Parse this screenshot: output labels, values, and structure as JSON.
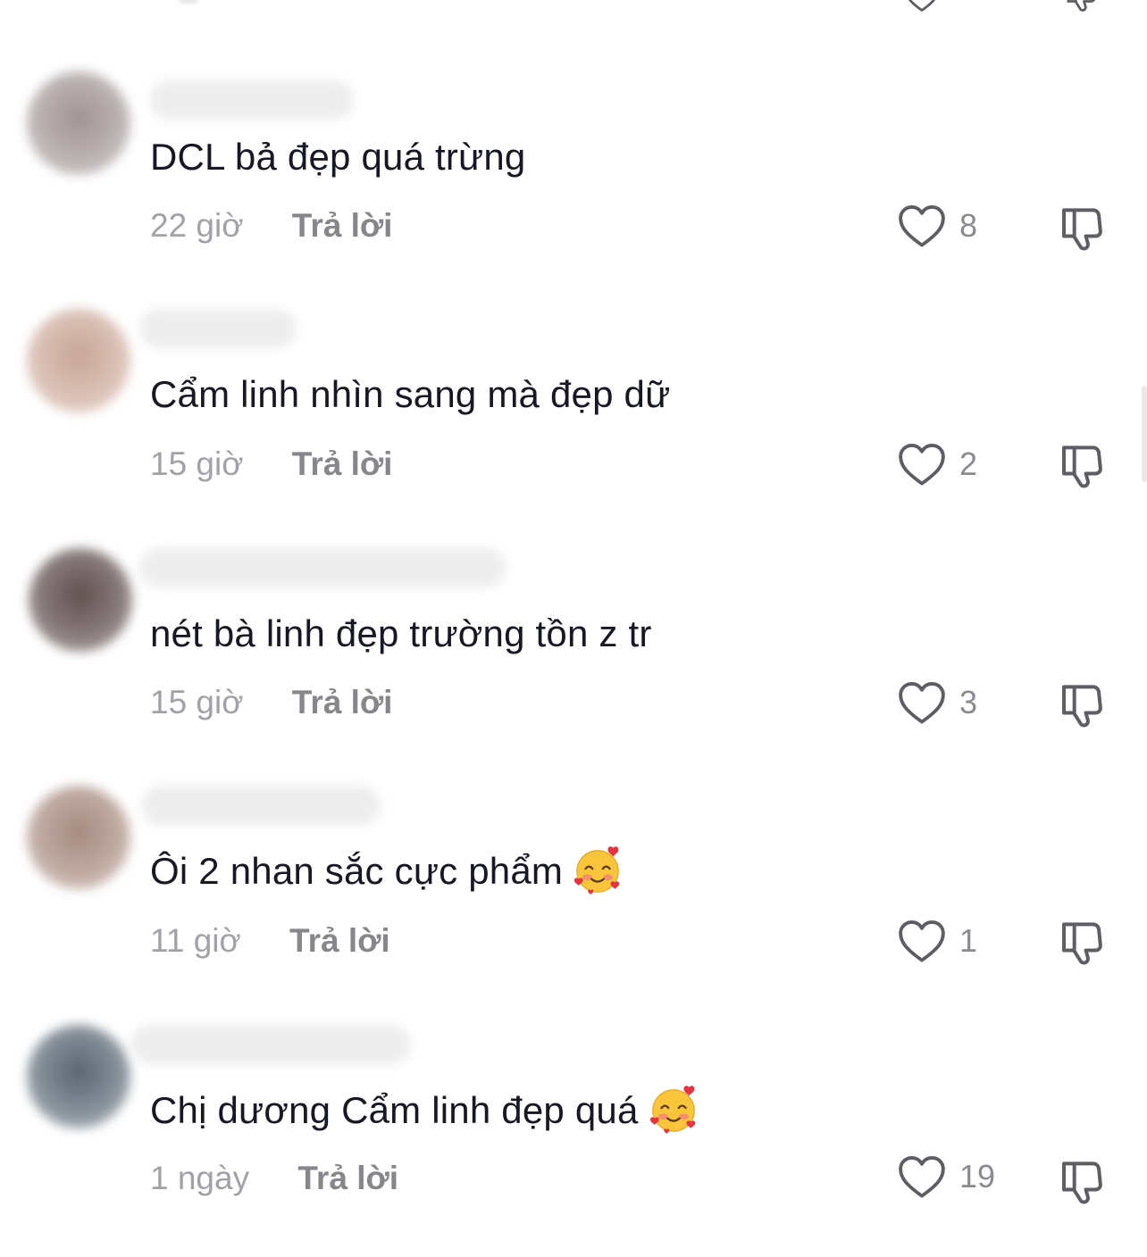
{
  "colors": {
    "text": "#161823",
    "meta": "#a1a2a7",
    "reply": "#86878b",
    "icon": "#5d5e63"
  },
  "icons": {
    "like": "heart-outline-icon",
    "dislike": "thumbs-down-icon",
    "emoji": "smiling-face-with-hearts-emoji"
  },
  "comments": [
    {
      "text": "DCL bả đẹp quá trừng",
      "time": "22 giờ",
      "reply": "Trả lời",
      "likes": "8"
    },
    {
      "text": "Cẩm linh nhìn sang mà đẹp dữ",
      "time": "15 giờ",
      "reply": "Trả lời",
      "likes": "2"
    },
    {
      "text": "nét bà linh đẹp trường tồn z tr",
      "time": "15 giờ",
      "reply": "Trả lời",
      "likes": "3"
    },
    {
      "text": "Ôi 2 nhan sắc cực phẩm",
      "time": "11 giờ",
      "reply": "Trả lời",
      "likes": "1"
    },
    {
      "text": "Chị dương Cẩm linh đẹp quá",
      "time": "1 ngày",
      "reply": "Trả lời",
      "likes": "19"
    }
  ]
}
